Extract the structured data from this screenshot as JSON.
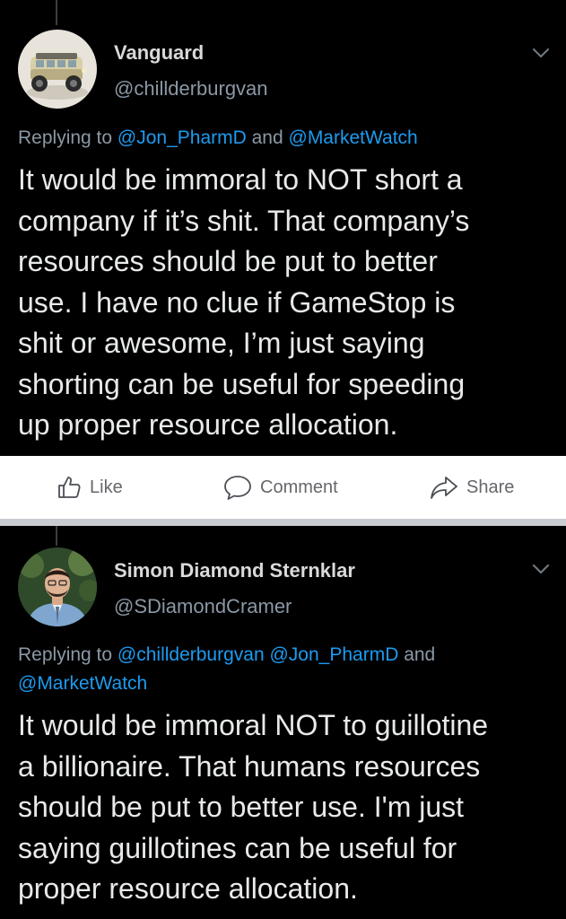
{
  "tweets": [
    {
      "display_name": "Vanguard",
      "handle": "@chillderburgvan",
      "replying_prefix": "Replying to",
      "mentions": [
        "@Jon_PharmD",
        "@MarketWatch"
      ],
      "joiners": [
        " and "
      ],
      "text": "It would be immoral to NOT short a\ncompany if it’s shit. That company’s\nresources should be put to better\nuse. I have no clue if GameStop is\nshit or awesome, I’m just saying\nshorting can be useful for speeding\nup proper resource allocation.",
      "avatar_icon": "van-avatar"
    },
    {
      "display_name": "Simon Diamond Sternklar",
      "handle": "@SDiamondCramer",
      "replying_prefix": "Replying to",
      "mentions": [
        "@chillderburgvan",
        "@Jon_PharmD",
        "@MarketWatch"
      ],
      "joiners": [
        " ",
        " and "
      ],
      "text": "It would be immoral NOT to guillotine\na billionaire. That humans resources\nshould be put to better use. I'm just\nsaying guillotines can be useful for\nproper resource allocation.",
      "avatar_icon": "person-avatar"
    }
  ],
  "actions": {
    "like_label": "Like",
    "comment_label": "Comment",
    "share_label": "Share"
  },
  "icons": {
    "like": "thumbs-up-icon",
    "comment": "comment-bubble-icon",
    "share": "share-arrow-icon",
    "more": "chevron-down-icon"
  },
  "colors": {
    "background": "#000000",
    "text": "#e7e9ea",
    "secondary": "#8b98a5",
    "mention": "#1d9bf0",
    "action_bar": "#ffffff",
    "action_text": "#65676b"
  }
}
